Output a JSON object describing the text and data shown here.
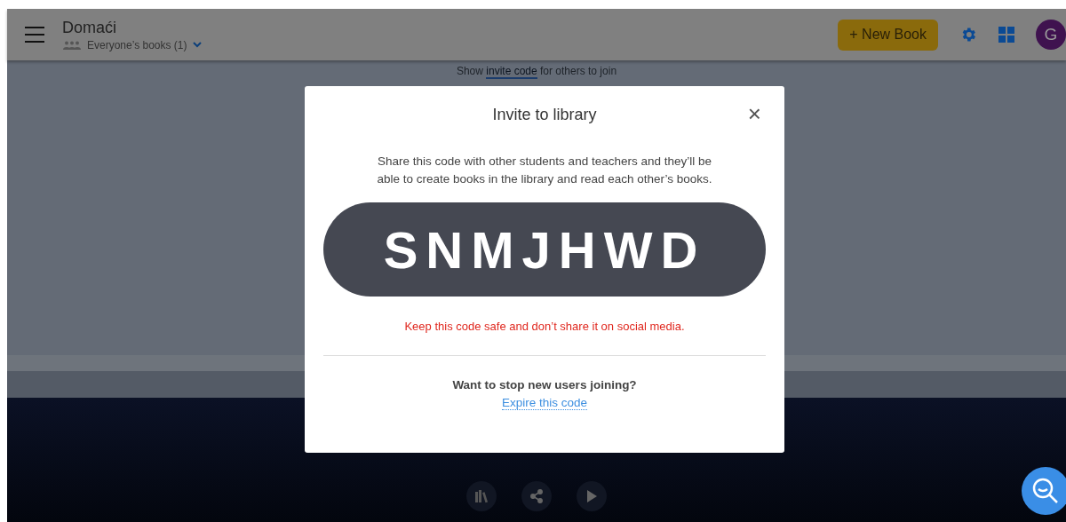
{
  "header": {
    "title": "Domaći",
    "subtitle": "Everyone’s books (1)",
    "new_book_button": "+ New Book",
    "avatar": "G"
  },
  "invite_hint": {
    "prefix": "Show ",
    "link": "invite code",
    "suffix": " for others to join"
  },
  "dialog": {
    "title": "Invite to library",
    "close": "×",
    "description": "Share this code with other students and teachers and they’ll be able to create books in the library and read each other’s books.",
    "code": "SNMJHWD",
    "warning": "Keep this code safe and don’t share it on social media.",
    "question": "Want to stop new users joining?",
    "expire_link": "Expire this code"
  }
}
